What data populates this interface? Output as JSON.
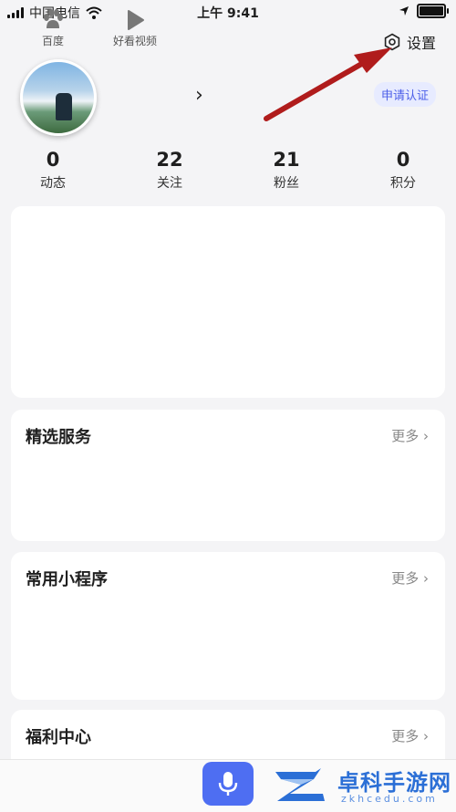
{
  "status_bar": {
    "carrier": "中国电信",
    "time": "上午 9:41"
  },
  "header": {
    "settings_label": "设置",
    "cert_label": "申请认证",
    "chevron": "›"
  },
  "stats": [
    {
      "value": "0",
      "label": "动态"
    },
    {
      "value": "22",
      "label": "关注"
    },
    {
      "value": "21",
      "label": "粉丝"
    },
    {
      "value": "0",
      "label": "积分"
    }
  ],
  "sections": {
    "services": {
      "title": "精选服务",
      "more": "更多 ›"
    },
    "miniapps": {
      "title": "常用小程序",
      "more": "更多 ›"
    },
    "welfare": {
      "title": "福利中心",
      "more": "更多 ›"
    }
  },
  "tabbar": {
    "home_label": "百度",
    "video_label": "好看视频"
  },
  "watermark": {
    "text": "卓科手游网",
    "sub": "zkhcedu.com"
  },
  "colors": {
    "accent": "#4e6ef2",
    "arrow": "#b01c1c"
  }
}
